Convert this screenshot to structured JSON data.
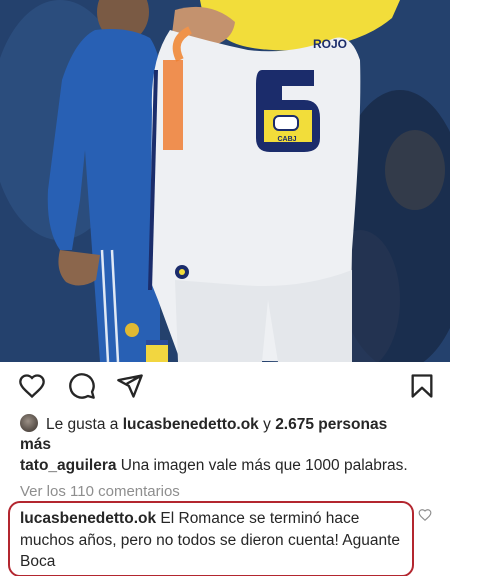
{
  "post": {
    "image_alt": "Players embracing on the pitch",
    "jersey_number": "6",
    "jersey_crest": "CABJ",
    "jersey_name_fragment": "ROJO"
  },
  "actions": {
    "like_icon": "heart-icon",
    "comment_icon": "comment-icon",
    "share_icon": "send-icon",
    "save_icon": "bookmark-icon"
  },
  "likes": {
    "prefix": "Le gusta a",
    "user": "lucasbenedetto.ok",
    "connector": "y",
    "count": "2.675 personas más"
  },
  "caption": {
    "username": "tato_aguilera",
    "text": "Una imagen vale más que 1000 palabras."
  },
  "view_comments": "Ver los 110 comentarios",
  "highlighted_comment": {
    "username": "lucasbenedetto.ok",
    "text": "El Romance se terminó hace muchos años, pero no todos se dieron cuenta! Aguante Boca",
    "border_color": "#b3262f"
  }
}
